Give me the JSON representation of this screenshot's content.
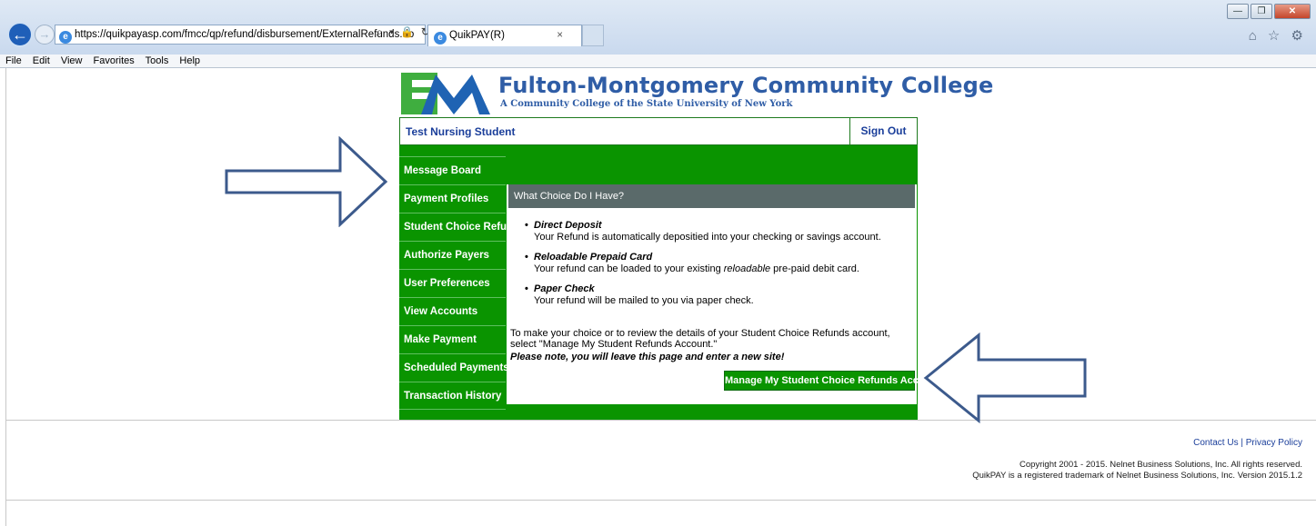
{
  "browser": {
    "url": "https://quikpayasp.com/fmcc/qp/refund/disbursement/ExternalRefunds.do",
    "tab_title": "QuikPAY(R)",
    "tab_close": "×",
    "address_icons": "⌕ ▾ 🔒 ↻",
    "menu": [
      "File",
      "Edit",
      "View",
      "Favorites",
      "Tools",
      "Help"
    ],
    "window_buttons": [
      "—",
      "❐",
      "✕"
    ],
    "toolbar_icons": "⌂ ☆ ⚙"
  },
  "college": {
    "name": "Fulton-Montgomery Community College",
    "subtitle": "A Community College of the State University of New York",
    "logo_text": "FM"
  },
  "user": {
    "name": "Test Nursing Student",
    "sign_out": "Sign Out"
  },
  "nav": {
    "items": [
      "Message Board",
      "Payment Profiles",
      "Student Choice Refunds",
      "Authorize Payers",
      "User Preferences",
      "View Accounts",
      "Make Payment",
      "Scheduled Payments",
      "Transaction History"
    ]
  },
  "content": {
    "heading": "What Choice Do I Have?",
    "choices": [
      {
        "title": "Direct Deposit",
        "desc": "Your Refund is automatically depositied into your checking or savings account."
      },
      {
        "title": "Reloadable Prepaid Card",
        "desc_pre": "Your refund can be loaded to your existing ",
        "desc_em": "reloadable",
        "desc_post": " pre-paid debit card."
      },
      {
        "title": "Paper Check",
        "desc": "Your refund will be mailed to you via paper check."
      }
    ],
    "bullet": "•",
    "instructions": "To make your choice or to review the details of your Student Choice Refunds account, select \"Manage My Student Refunds Account.\"",
    "note": "Please note, you will leave this page and enter a new site!",
    "manage_button": "Manage My Student Choice Refunds Account"
  },
  "footer": {
    "contact": "Contact Us",
    "separator": "|",
    "privacy": "Privacy Policy",
    "copyright_line1": "Copyright 2001 - 2015. Nelnet Business Solutions, Inc. All rights reserved.",
    "copyright_line2": "QuikPAY is a registered trademark of Nelnet Business Solutions, Inc. Version 2015.1.2"
  },
  "colors": {
    "green": "#0a9400",
    "navy_text": "#1a3e9a",
    "college_blue": "#2f5da6",
    "header_gray": "#5a6a6a",
    "arrow_blue": "#3c5a8c"
  }
}
